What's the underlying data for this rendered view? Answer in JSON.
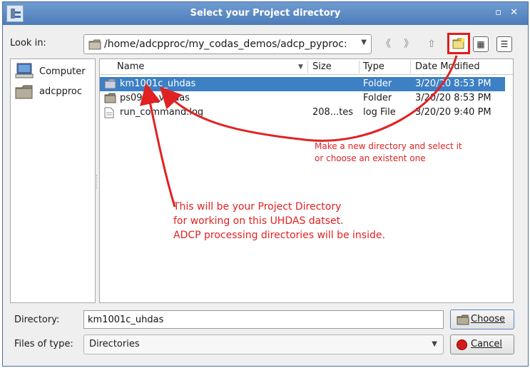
{
  "window": {
    "title": "Select your Project directory",
    "controls": "▫ ✕"
  },
  "toolbar": {
    "look_in_label": "Look in:",
    "path": "/home/adcpproc/my_codas_demos/adcp_pyproc:",
    "back_icon": "back-arrow-icon",
    "forward_icon": "forward-arrow-icon",
    "up_icon": "up-arrow-icon",
    "new_folder_icon": "new-folder-icon",
    "detail_view_icon": "detail-view-icon",
    "list_view_icon": "list-view-icon"
  },
  "sidebar": {
    "items": [
      {
        "label": "Computer",
        "icon": "computer-icon"
      },
      {
        "label": "adcpproc",
        "icon": "folder-icon"
      }
    ]
  },
  "columns": {
    "name": "Name",
    "size": "Size",
    "type": "Type",
    "date": "Date Modified"
  },
  "files": [
    {
      "name": "km1001c_uhdas",
      "size": "",
      "type": "Folder",
      "date": "3/20/20 8:53 PM",
      "icon": "folder-icon",
      "selected": true
    },
    {
      "name": "ps0918_vmdas",
      "size": "",
      "type": "Folder",
      "date": "3/20/20 8:53 PM",
      "icon": "folder-icon",
      "selected": false
    },
    {
      "name": "run_command.log",
      "size": "208...tes",
      "type": "log File",
      "date": "3/20/20 9:40 PM",
      "icon": "file-icon",
      "selected": false
    }
  ],
  "form": {
    "directory_label": "Directory:",
    "directory_value": "km1001c_uhdas",
    "files_of_type_label": "Files of type:",
    "files_of_type_value": "Directories",
    "choose_label": "Choose",
    "cancel_label": "Cancel"
  },
  "annotations": {
    "new_dir_line1": "Make a new directory and select it",
    "new_dir_line2": "or choose an existent one",
    "project_line1": "This will be your Project Directory",
    "project_line2": "for working on this UHDAS datset.",
    "project_line3": "ADCP processing directories will be inside."
  },
  "colors": {
    "selection": "#3d80c4",
    "annotation": "#e02222",
    "titlebar": "#5a88c2"
  }
}
